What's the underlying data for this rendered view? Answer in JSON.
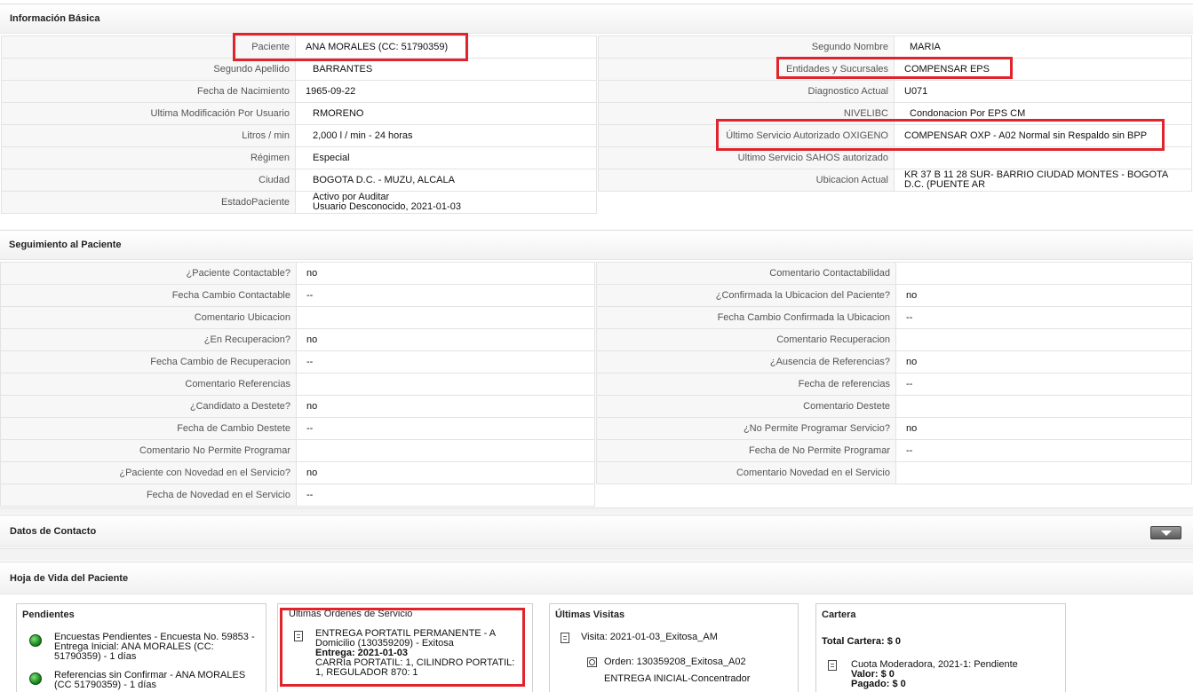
{
  "info": {
    "title": "Información Básica",
    "left": [
      {
        "label": "Paciente",
        "value": "ANA MORALES (CC: 51790359)"
      },
      {
        "label": "Segundo Apellido",
        "value": "BARRANTES"
      },
      {
        "label": "Fecha de Nacimiento",
        "value": "1965-09-22"
      },
      {
        "label": "Ultima Modificación Por Usuario",
        "value": "RMORENO"
      },
      {
        "label": "Litros / min",
        "value": "2,000 l / min - 24 horas"
      },
      {
        "label": "Régimen",
        "value": "Especial"
      },
      {
        "label": "Ciudad",
        "value": "BOGOTA D.C. - MUZU, ALCALA"
      },
      {
        "label": "EstadoPaciente",
        "value": "Activo por Auditar",
        "value2": "Usuario Desconocido, 2021-01-03"
      }
    ],
    "right": [
      {
        "label": "Segundo Nombre",
        "value": "MARIA"
      },
      {
        "label": "Entidades y Sucursales",
        "value": "COMPENSAR EPS"
      },
      {
        "label": "Diagnostico Actual",
        "value": "U071"
      },
      {
        "label": "NIVELIBC",
        "value": "Condonacion Por EPS CM"
      },
      {
        "label": "Último Servicio Autorizado OXIGENO",
        "value": "COMPENSAR OXP - A02 Normal sin Respaldo sin BPP"
      },
      {
        "label": "Ultimo Servicio SAHOS autorizado",
        "value": ""
      },
      {
        "label": "Ubicacion Actual",
        "value": "KR 37 B 11 28 SUR- BARRIO CIUDAD MONTES - BOGOTA D.C. (PUENTE AR"
      }
    ]
  },
  "seguimiento": {
    "title": "Seguimiento al Paciente",
    "left": [
      {
        "label": "¿Paciente Contactable?",
        "value": "no"
      },
      {
        "label": "Fecha Cambio Contactable",
        "value": "--"
      },
      {
        "label": "Comentario Ubicacion",
        "value": ""
      },
      {
        "label": "¿En Recuperacion?",
        "value": "no"
      },
      {
        "label": "Fecha Cambio de Recuperacion",
        "value": "--"
      },
      {
        "label": "Comentario Referencias",
        "value": ""
      },
      {
        "label": "¿Candidato a Destete?",
        "value": "no"
      },
      {
        "label": "Fecha de Cambio Destete",
        "value": "--"
      },
      {
        "label": "Comentario No Permite Programar",
        "value": ""
      },
      {
        "label": "¿Paciente con Novedad en el Servicio?",
        "value": "no"
      },
      {
        "label": "Fecha de Novedad en el Servicio",
        "value": "--"
      }
    ],
    "right": [
      {
        "label": "Comentario Contactabilidad",
        "value": ""
      },
      {
        "label": "¿Confirmada la Ubicacion del Paciente?",
        "value": "no"
      },
      {
        "label": "Fecha Cambio Confirmada la Ubicacion",
        "value": "--"
      },
      {
        "label": "Comentario Recuperacion",
        "value": ""
      },
      {
        "label": "¿Ausencia de Referencias?",
        "value": "no"
      },
      {
        "label": "Fecha de referencias",
        "value": "--"
      },
      {
        "label": "Comentario Destete",
        "value": ""
      },
      {
        "label": "¿No Permite Programar Servicio?",
        "value": "no"
      },
      {
        "label": "Fecha de No Permite Programar",
        "value": "--"
      },
      {
        "label": "Comentario Novedad en el Servicio",
        "value": ""
      }
    ]
  },
  "contacto": {
    "title": "Datos de Contacto"
  },
  "hoja": {
    "title": "Hoja de Vida del Paciente",
    "pendientes": {
      "title": "Pendientes",
      "items": [
        "Encuestas Pendientes - Encuesta No. 59853 - Entrega Inicial: ANA MORALES (CC: 51790359) - 1 días",
        "Referencias sin Confirmar - ANA MORALES (CC 51790359) - 1 días"
      ]
    },
    "ordenes": {
      "title": "Últimas Ordenes de Servicio",
      "line1": "ENTREGA PORTATIL PERMANENTE - A Domicilio (130359209) - Exitosa",
      "line2": "Entrega: 2021-01-03",
      "line3": "CARRIa PORTATIL: 1, CILINDRO PORTATIL: 1, REGULADOR 870: 1"
    },
    "visitas": {
      "title": "Últimas Visitas",
      "visita": "Visita: 2021-01-03_Exitosa_AM",
      "orden": "Orden: 130359208_Exitosa_A02",
      "detalle": "ENTREGA INICIAL-Concentrador"
    },
    "cartera": {
      "title": "Cartera",
      "total": "Total Cartera: $ 0",
      "item": "Cuota Moderadora, 2021-1: Pendiente",
      "valor": "Valor: $ 0",
      "pagado": "Pagado: $ 0"
    }
  }
}
